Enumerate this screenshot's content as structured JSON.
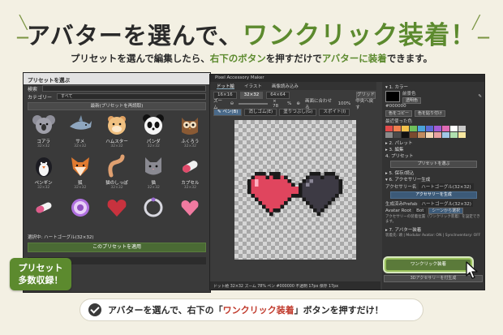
{
  "hero": {
    "pre": "アバターを選んで、",
    "highlight": "ワンクリック装着！",
    "sub_pre": "プリセットを選んで編集したら、",
    "sub_hl1": "右下のボタン",
    "sub_mid": "を押すだけで",
    "sub_hl2": "アバターに装着",
    "sub_post": "できます。"
  },
  "left_window": {
    "title": "プリセットを選ぶ",
    "search_label": "検索",
    "category_label": "カテゴリー",
    "category_value": "すべて",
    "action_button": "最新(プリセットを再読取)",
    "presets": [
      {
        "name": "コアラ",
        "size": "32×32",
        "icon": "koala-icon"
      },
      {
        "name": "サメ",
        "size": "32×32",
        "icon": "shark-icon"
      },
      {
        "name": "ハムスター",
        "size": "32×32",
        "icon": "hamster-icon"
      },
      {
        "name": "パンダ",
        "size": "32×32",
        "icon": "panda-icon"
      },
      {
        "name": "ふくろう",
        "size": "32×32",
        "icon": "owl-icon"
      },
      {
        "name": "ペンギン",
        "size": "32×32",
        "icon": "penguin-icon"
      },
      {
        "name": "狐",
        "size": "32×32",
        "icon": "fox-icon"
      },
      {
        "name": "猫のしっぽ",
        "size": "32×32",
        "icon": "cat-tail-icon"
      },
      {
        "name": "猫",
        "size": "32×32",
        "icon": "cat-icon"
      },
      {
        "name": "カプセル",
        "size": "32×32",
        "icon": "capsule-icon"
      },
      {
        "name": "",
        "size": "",
        "icon": "pill-icon"
      },
      {
        "name": "",
        "size": "",
        "icon": "badge-icon"
      },
      {
        "name": "",
        "size": "",
        "icon": "heart-icon"
      },
      {
        "name": "",
        "size": "",
        "icon": "ring-icon"
      },
      {
        "name": "",
        "size": "",
        "icon": "pink-heart-icon"
      }
    ],
    "selected_text": "選択中: ハートゴーグル(32×32)",
    "apply_button": "このプリセットを適用",
    "detail_label": "プリセット詳細"
  },
  "badge": {
    "line1": "プリセット",
    "line2": "多数収録！"
  },
  "right_window": {
    "title": "Pixel Accessory Maker",
    "tabs": [
      "ドット絵",
      "イラスト",
      "画像読み込み"
    ],
    "sizes": [
      "16×16",
      "32×32",
      "64×64"
    ],
    "grid_button": "グリッド",
    "zoom_label": "ズーム",
    "zoom_value": "× 78",
    "zoom_percent": "%",
    "fit_label": "画面に合わせる",
    "percent_100": "100%",
    "center_label": "中央へ戻す",
    "tools": [
      "✎ ペン(B)",
      "消しゴム(E)",
      "塗りつぶし(G)",
      "スポイト(I)"
    ],
    "status": "ドット絵   32×32   ズーム 78%   ペン   #000000   不透明 17px   保存 17px",
    "panel": {
      "color_head": "▾ 1. カラー",
      "color_preview_label": "前景色",
      "transparent_btn": "透明色",
      "hex": "#000000",
      "copy_btn": "色をコピー",
      "paste_btn": "色を貼り付け",
      "recent_label": "最近使った色",
      "palette_head": "▸ 2. パレット",
      "edit_head": "▸ 3. 編集",
      "preset_head": "4. プリセット",
      "preset_btn": "プリセットを選ぶ",
      "save_head": "▸ 5. 保存/読込",
      "gen_head": "▾ 6. アクセサリー生成",
      "acc_name_label": "アクセサリー名",
      "acc_name_value": "ハートゴーグル(32×32)",
      "gen_btn": "アクセサリーを生成",
      "prefab_label": "生成済みPrefab",
      "prefab_value": "ハートゴーグル(32×32)",
      "avatar_root_label": "Avatar Root",
      "avatar_root_value": "Bot",
      "scene_btn": "シーンから選択",
      "note": "アクセサリーの装着位置（ワンクリック装着）を設定できます。",
      "attach_head": "▸ 7. アバター装着",
      "attach_status": "装着先: 頭 | Modular Avatar: ON | SyncInventory: OFF",
      "oneclick_btn": "ワンクリック装着",
      "oneclick2_btn": "3Dアクセサリーを付生成"
    }
  },
  "bottom": {
    "pre": "アバターを選んで、右下の「",
    "hl": "ワンクリック装着",
    "post": "」ボタンを押すだけ！"
  },
  "colors": {
    "accent": "#5c8a2e",
    "background": "#f3f0e3",
    "heart": "#e0455e",
    "heart_dark": "#3d3a44"
  },
  "swatch_colors": [
    "#e34b4b",
    "#f07f4e",
    "#f3c24c",
    "#6fbf5b",
    "#4aa3d9",
    "#5b6bd6",
    "#a35bd6",
    "#e06bb3",
    "#ffffff",
    "#c9c9c9",
    "#8a8a8a",
    "#4a4a4a",
    "#111111",
    "#7b4a2e",
    "#c08a5e",
    "#f2d6b4",
    "#e8a0a0",
    "#a0c8e8",
    "#b0e0b0",
    "#f8e8a0"
  ]
}
